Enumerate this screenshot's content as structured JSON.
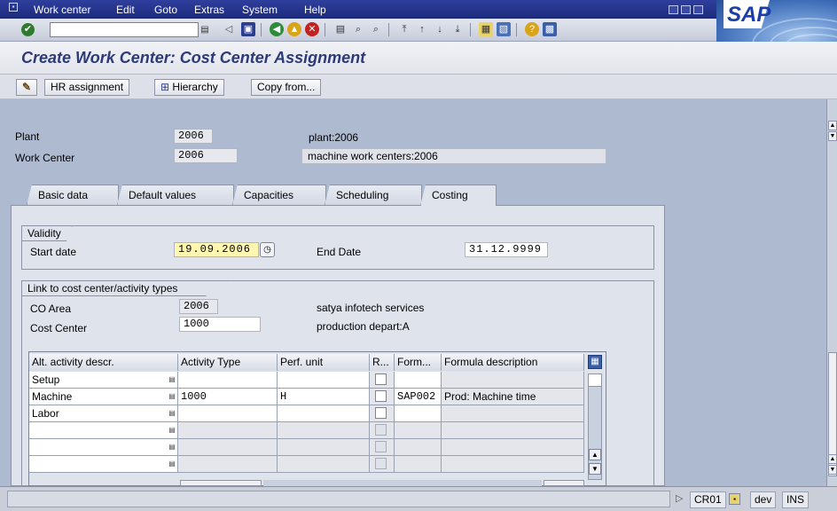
{
  "menu": {
    "items": [
      "Work center",
      "Edit",
      "Goto",
      "Extras",
      "System",
      "Help"
    ]
  },
  "logo": {
    "text": "SAP"
  },
  "title": "Create Work Center: Cost Center Assignment",
  "app_toolbar": {
    "hr_assignment": "HR assignment",
    "hierarchy": "Hierarchy",
    "copy_from": "Copy from..."
  },
  "header": {
    "plant_label": "Plant",
    "plant_value": "2006",
    "plant_desc": "plant:2006",
    "work_center_label": "Work Center",
    "work_center_value": "2006",
    "work_center_desc": "machine work centers:2006"
  },
  "tabs": [
    "Basic data",
    "Default values",
    "Capacities",
    "Scheduling",
    "Costing"
  ],
  "active_tab": "Costing",
  "validity": {
    "title": "Validity",
    "start_label": "Start date",
    "start_value": "19.09.2006",
    "end_label": "End Date",
    "end_value": "31.12.9999"
  },
  "link": {
    "title": "Link to cost center/activity types",
    "co_area_label": "CO Area",
    "co_area_value": "2006",
    "co_area_desc": "satya infotech  services",
    "cost_center_label": "Cost Center",
    "cost_center_value": "1000",
    "cost_center_desc": "production depart:A"
  },
  "grid": {
    "columns": [
      "Alt. activity descr.",
      "Activity Type",
      "Perf. unit",
      "R...",
      "Form...",
      "Formula description"
    ],
    "rows": [
      {
        "alt": "Setup",
        "activity_type": "",
        "perf_unit": "",
        "formula": "",
        "formula_desc": ""
      },
      {
        "alt": "Machine",
        "activity_type": "1000",
        "perf_unit": "H",
        "formula": "SAP002",
        "formula_desc": "Prod: Machine time"
      },
      {
        "alt": "Labor",
        "activity_type": "",
        "perf_unit": "",
        "formula": "",
        "formula_desc": ""
      },
      {
        "alt": "",
        "activity_type": "",
        "perf_unit": "",
        "formula": "",
        "formula_desc": ""
      },
      {
        "alt": "",
        "activity_type": "",
        "perf_unit": "",
        "formula": "",
        "formula_desc": ""
      },
      {
        "alt": "",
        "activity_type": "",
        "perf_unit": "",
        "formula": "",
        "formula_desc": ""
      }
    ]
  },
  "status": {
    "transaction": "CR01",
    "system": "dev",
    "mode": "INS"
  },
  "colors": {
    "menubar": "#1c2a7c",
    "title_text": "#2c3a78",
    "required_field": "#fff6b0"
  }
}
